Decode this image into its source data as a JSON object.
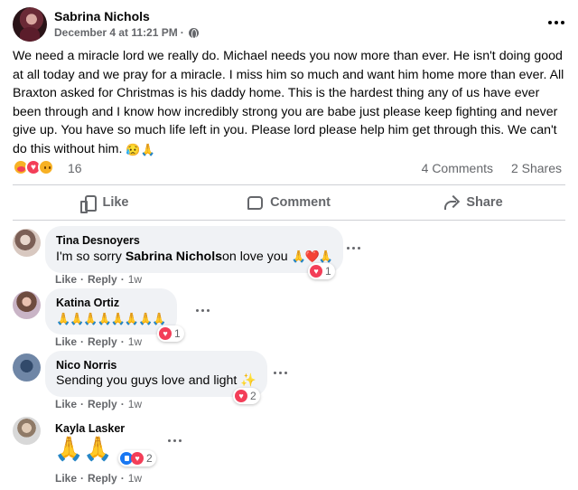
{
  "post": {
    "author": "Sabrina Nichols",
    "timestamp": "December 4 at 11:21 PM",
    "meta_separator": "·",
    "text": "We need a miracle lord we really do. Michael needs you now more than ever. He isn't doing good at all today and we pray for a miracle. I miss him so much and want him home more than ever. All Braxton asked for Christmas is his daddy home. This is the hardest thing any of us have ever been through and I know how incredibly strong you are babe just please keep fighting and never give up. You have so much life left in you. Please lord please help him get through this. We can't do this without him.",
    "text_emojis": "😥🙏",
    "reactions": [
      "care",
      "love",
      "sad"
    ],
    "reaction_count": "16",
    "comments_count": "4 Comments",
    "shares_count": "2 Shares"
  },
  "actions": {
    "like": "Like",
    "comment": "Comment",
    "share": "Share"
  },
  "comments": [
    {
      "name": "Tina Desnoyers",
      "text_before": "I'm so sorry ",
      "mention": "Sabrina Nichols",
      "text_after": "on love you ",
      "emojis": "🙏❤️🙏",
      "reaction_count": "1",
      "like": "Like",
      "reply": "Reply",
      "time": "1w"
    },
    {
      "name": "Katina Ortiz",
      "text": "🙏🙏🙏🙏🙏🙏🙏🙏",
      "reaction_count": "1",
      "like": "Like",
      "reply": "Reply",
      "time": "1w"
    },
    {
      "name": "Nico Norris",
      "text": "Sending you guys love and light ",
      "emojis": "✨",
      "reaction_count": "2",
      "like": "Like",
      "reply": "Reply",
      "time": "1w"
    },
    {
      "name": "Kayla Lasker",
      "text": "🙏🙏",
      "reaction_count": "2",
      "like": "Like",
      "reply": "Reply",
      "time": "1w"
    }
  ],
  "meta_dot": "·",
  "colors": {
    "secondary_text": "#65676b",
    "bubble": "#f0f2f5",
    "divider": "#ced0d4",
    "love": "#f33e58",
    "like_blue": "#1877f2"
  }
}
